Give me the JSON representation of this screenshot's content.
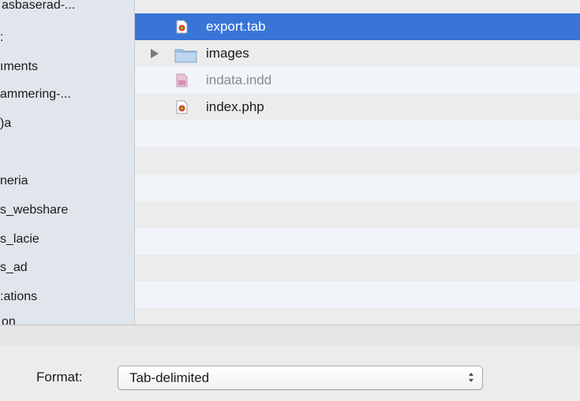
{
  "sidebar": {
    "items": [
      {
        "label": "asbaserad-..."
      },
      {
        "label": ":"
      },
      {
        "label": "ıments"
      },
      {
        "label": "ammering-..."
      },
      {
        "label": ")a"
      },
      {
        "label": ""
      },
      {
        "label": "neria"
      },
      {
        "label": "s_webshare"
      },
      {
        "label": "s_lacie"
      },
      {
        "label": "s_ad"
      },
      {
        "label": ":ations"
      },
      {
        "label": "on"
      }
    ]
  },
  "files": [
    {
      "name": "export.tab",
      "icon": "web-document-icon",
      "selected": true
    },
    {
      "name": "images",
      "icon": "folder-icon",
      "expandable": true
    },
    {
      "name": "indata.indd",
      "icon": "indesign-document-icon",
      "dimmed": true
    },
    {
      "name": "index.php",
      "icon": "web-document-icon"
    }
  ],
  "bottom": {
    "format_label": "Format:",
    "format_value": "Tab-delimited"
  },
  "colors": {
    "selection": "#3875d7",
    "sidebar_bg": "#e1e6ed",
    "stripe": "#f1f4f8"
  }
}
